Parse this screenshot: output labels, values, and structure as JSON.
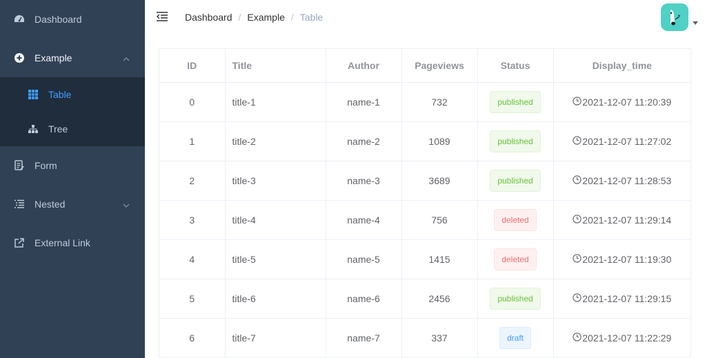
{
  "sidebar": {
    "items": [
      {
        "label": "Dashboard",
        "icon": "dashboard-icon"
      },
      {
        "label": "Example",
        "icon": "example-icon",
        "expanded": true,
        "children": [
          {
            "label": "Table",
            "icon": "table-icon",
            "active": true
          },
          {
            "label": "Tree",
            "icon": "tree-icon"
          }
        ]
      },
      {
        "label": "Form",
        "icon": "form-icon"
      },
      {
        "label": "Nested",
        "icon": "nested-icon"
      },
      {
        "label": "External Link",
        "icon": "link-icon"
      }
    ]
  },
  "navbar": {
    "breadcrumb": [
      "Dashboard",
      "Example",
      "Table"
    ]
  },
  "table": {
    "headers": [
      "ID",
      "Title",
      "Author",
      "Pageviews",
      "Status",
      "Display_time"
    ],
    "rows": [
      {
        "id": "0",
        "title": "title-1",
        "author": "name-1",
        "pageviews": "732",
        "status": "published",
        "time": "2021-12-07 11:20:39"
      },
      {
        "id": "1",
        "title": "title-2",
        "author": "name-2",
        "pageviews": "1089",
        "status": "published",
        "time": "2021-12-07 11:27:02"
      },
      {
        "id": "2",
        "title": "title-3",
        "author": "name-3",
        "pageviews": "3689",
        "status": "published",
        "time": "2021-12-07 11:28:53"
      },
      {
        "id": "3",
        "title": "title-4",
        "author": "name-4",
        "pageviews": "756",
        "status": "deleted",
        "time": "2021-12-07 11:29:14"
      },
      {
        "id": "4",
        "title": "title-5",
        "author": "name-5",
        "pageviews": "1415",
        "status": "deleted",
        "time": "2021-12-07 11:19:30"
      },
      {
        "id": "5",
        "title": "title-6",
        "author": "name-6",
        "pageviews": "2456",
        "status": "published",
        "time": "2021-12-07 11:29:15"
      },
      {
        "id": "6",
        "title": "title-7",
        "author": "name-7",
        "pageviews": "337",
        "status": "draft",
        "time": "2021-12-07 11:22:29"
      }
    ]
  },
  "colors": {
    "sidebar_bg": "#304156",
    "submenu_bg": "#1f2d3d",
    "active": "#409eff",
    "published": "#67c23a",
    "deleted": "#f56c6c",
    "draft": "#409eff"
  }
}
